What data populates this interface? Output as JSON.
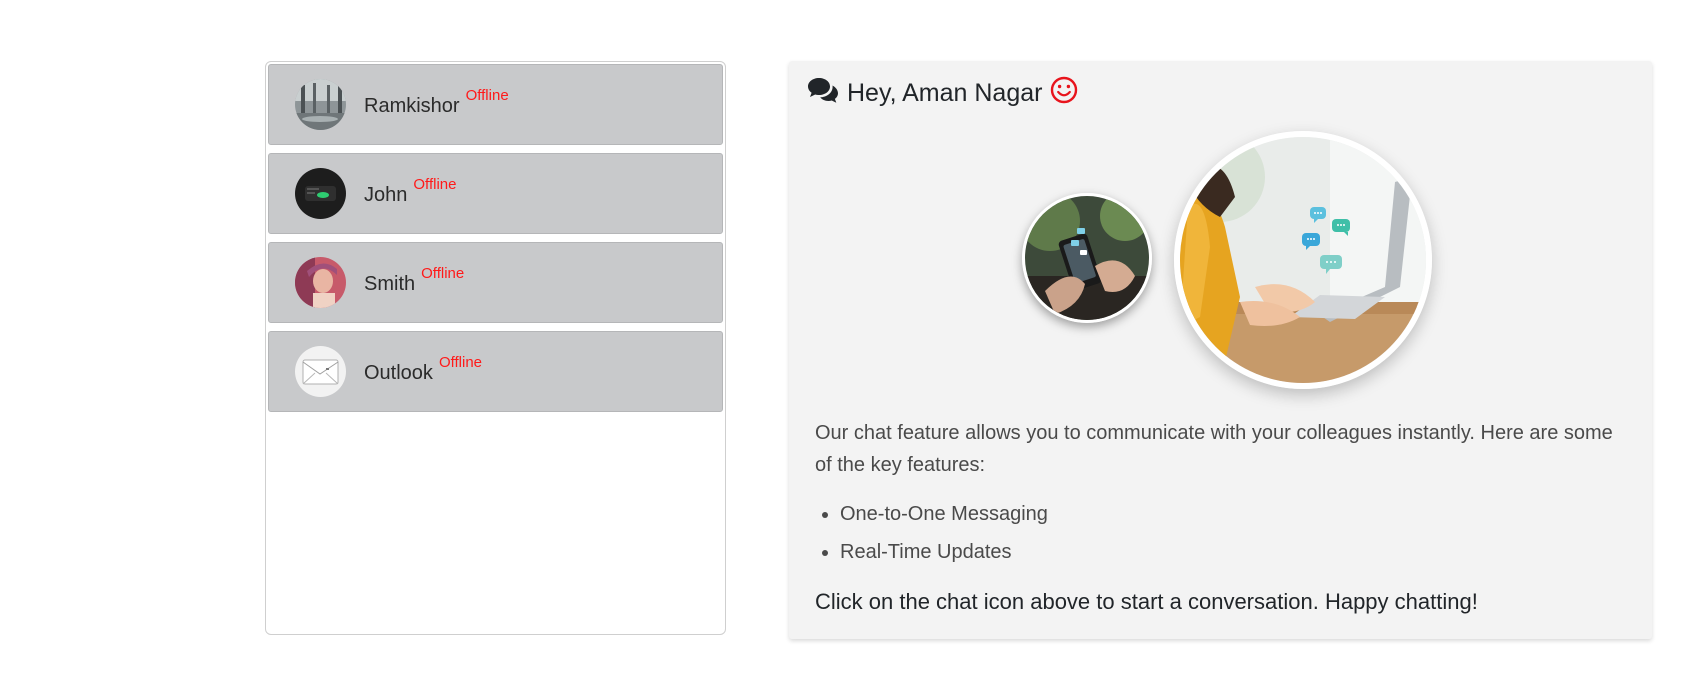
{
  "contacts": [
    {
      "name": "Ramkishor",
      "status": "Offline",
      "avatar": "office-photo"
    },
    {
      "name": "John",
      "status": "Offline",
      "avatar": "dark-device-photo"
    },
    {
      "name": "Smith",
      "status": "Offline",
      "avatar": "portrait-photo"
    },
    {
      "name": "Outlook",
      "status": "Offline",
      "avatar": "envelope-sketch"
    }
  ],
  "welcome": {
    "greeting": "Hey, Aman Nagar",
    "greeting_icon": "comments-icon",
    "emoji_icon": "smile-icon",
    "intro": "Our chat feature allows you to communicate with your colleagues instantly. Here are some of the key features:",
    "features": [
      "One-to-One Messaging",
      "Real-Time Updates"
    ],
    "cta": "Click on the chat icon above to start a conversation. Happy chatting!"
  },
  "colors": {
    "status_offline": "#ff1a1a",
    "contact_bg": "#c8c9cb",
    "panel_bg": "#f3f3f3"
  }
}
